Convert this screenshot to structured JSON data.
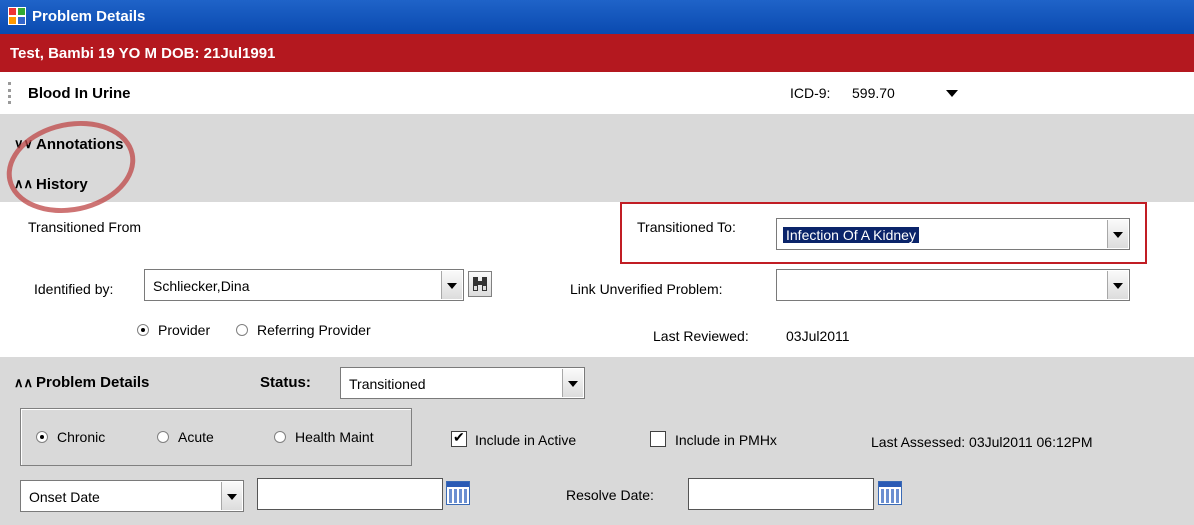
{
  "window": {
    "title": "Problem Details",
    "icon": "app-window-icon"
  },
  "patient_banner": "Test, Bambi  19 YO  M DOB: 21Jul1991",
  "problem": {
    "name": "Blood In Urine",
    "icd_label": "ICD-9:",
    "icd_value": "599.70"
  },
  "sections": {
    "annotations": "Annotations",
    "history": "History",
    "problem_details": "Problem Details"
  },
  "history": {
    "transitioned_from_label": "Transitioned From",
    "transitioned_to_label": "Transitioned To:",
    "transitioned_to_value": "Infection Of A Kidney",
    "identified_by_label": "Identified by:",
    "identified_by_value": "Schliecker,Dina",
    "link_unverified_label": "Link Unverified Problem:",
    "link_unverified_value": "",
    "provider_label": "Provider",
    "referring_provider_label": "Referring Provider",
    "last_reviewed_label": "Last Reviewed:",
    "last_reviewed_value": "03Jul2011"
  },
  "details": {
    "status_label": "Status:",
    "status_value": "Transitioned",
    "chronic_label": "Chronic",
    "acute_label": "Acute",
    "health_maint_label": "Health Maint",
    "include_active_label": "Include in Active",
    "include_pmhx_label": "Include in PMHx",
    "last_assessed": "Last Assessed: 03Jul2011 06:12PM",
    "onset_select_value": "Onset Date",
    "onset_date_value": "",
    "resolve_date_label": "Resolve Date:",
    "resolve_date_value": ""
  },
  "colors": {
    "title_bar": "#0a4ab0",
    "patient_banner": "#b4181f",
    "section_gray": "#d9d9d9",
    "highlight_box": "#c11d24"
  }
}
